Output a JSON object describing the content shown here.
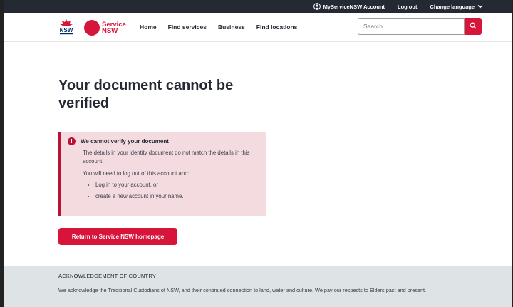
{
  "topbar": {
    "account_label": "MyServiceNSW Account",
    "logout_label": "Log out",
    "language_label": "Change language"
  },
  "header": {
    "logo_nsw_text": "NSW",
    "logo_service_line1": "Service",
    "logo_service_line2": "NSW",
    "nav": [
      "Home",
      "Find services",
      "Business",
      "Find locations"
    ],
    "search_placeholder": "Search"
  },
  "main": {
    "title": "Your document cannot be verified",
    "alert": {
      "heading": "We cannot verify your document",
      "paragraph1": "The details in your identity document do not match the details in this account.",
      "paragraph2": "You will need to log out of this account and:",
      "items": [
        "Log in to your account, or",
        "create a new account in your name."
      ]
    },
    "cta_label": "Return to Service NSW homepage"
  },
  "footer": {
    "heading": "ACKNOWLEDGEMENT OF COUNTRY",
    "text": "We acknowledge the Traditional Custodians of NSW, and their continued connection to land, water and culture. We pay our respects to Elders past and present."
  },
  "colors": {
    "brand_red": "#d7153a",
    "alert_bg": "#f4dbe0",
    "dark": "#242934"
  }
}
